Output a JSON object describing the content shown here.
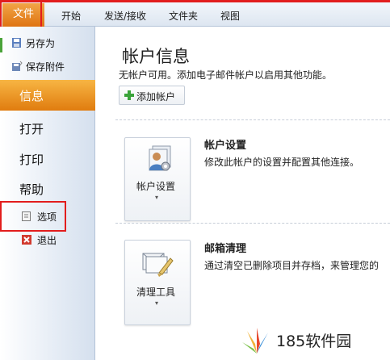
{
  "ribbon": {
    "tabs": [
      "文件",
      "开始",
      "发送/接收",
      "文件夹",
      "视图"
    ],
    "file_tab_color": "#e57b19",
    "highlight_color": "#e21d1d"
  },
  "sidebar": {
    "commands": [
      {
        "label": "另存为",
        "icon": "save-as-icon"
      },
      {
        "label": "保存附件",
        "icon": "save-attachments-icon"
      }
    ],
    "nav": [
      "信息",
      "打开",
      "打印",
      "帮助"
    ],
    "active": "信息",
    "bottom_commands": [
      {
        "label": "选项",
        "icon": "options-icon"
      },
      {
        "label": "退出",
        "icon": "exit-icon"
      }
    ]
  },
  "main": {
    "title": "帐户信息",
    "subtitle": "无帐户可用。添加电子邮件帐户以启用其他功能。",
    "add_account_label": "添加帐户",
    "sections": [
      {
        "button_label": "帐户设置",
        "heading": "帐户设置",
        "description": "修改此帐户的设置并配置其他连接。",
        "icon": "account-settings-icon"
      },
      {
        "button_label": "清理工具",
        "heading": "邮箱清理",
        "description": "通过清空已删除项目并存档，来管理您的",
        "icon": "cleanup-tools-icon"
      }
    ]
  },
  "watermark": {
    "text": "185软件园",
    "logo": "colorful-leaf-logo"
  }
}
